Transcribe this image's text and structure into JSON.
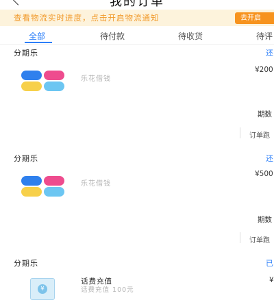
{
  "header": {
    "title": "我的订单",
    "back_icon": "chevron-left-icon"
  },
  "notice": {
    "text": "查看物流实时进度，点击开启物流通知",
    "button": "去开启"
  },
  "tabs": [
    {
      "label": "全部"
    },
    {
      "label": "待付款"
    },
    {
      "label": "待收货"
    },
    {
      "label": "待评"
    }
  ],
  "colors": {
    "accent": "#2d7ff9",
    "notice_bg": "#fdf3dc",
    "notice_text": "#f19a2b",
    "notice_button": "#f7931e"
  },
  "orders": [
    {
      "shop": "分期乐",
      "status": "还",
      "item_name": "乐花借钱",
      "price": "¥200",
      "periods_label": "期数",
      "order_label": "订单跑"
    },
    {
      "shop": "分期乐",
      "status": "还",
      "item_name": "乐花借钱",
      "price": "¥500",
      "periods_label": "期数",
      "order_label": "订单跑"
    },
    {
      "shop": "分期乐",
      "status": "已",
      "item_name": "话费充值",
      "item_sub": "话费充值 100元",
      "price": "¥",
      "icon": "phone-recharge-icon"
    }
  ]
}
